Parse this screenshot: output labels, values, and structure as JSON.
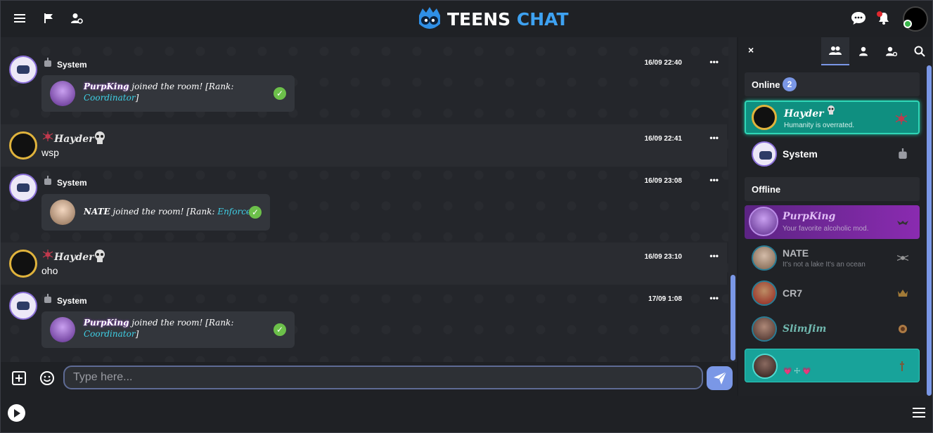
{
  "header": {
    "logo_text_a": "TEENS",
    "logo_text_b": "CHAT"
  },
  "messages": [
    {
      "user": "System",
      "time": "16/09 22:40",
      "menu": "•••",
      "notice": {
        "who": "PurpKing",
        "pre": " joined the room! [Rank: ",
        "rank": "Coordinator",
        "post": "]"
      }
    },
    {
      "user": "Hayder",
      "time": "16/09 22:41",
      "menu": "•••",
      "text": "wsp"
    },
    {
      "user": "System",
      "time": "16/09 23:08",
      "menu": "•••",
      "notice": {
        "who": "NATE",
        "pre": " joined the room! [Rank: ",
        "rank": "Enforcer",
        "post": "]"
      }
    },
    {
      "user": "Hayder",
      "time": "16/09 23:10",
      "menu": "•••",
      "text": "oho"
    },
    {
      "user": "System",
      "time": "17/09 1:08",
      "menu": "•••",
      "notice": {
        "who": "PurpKing",
        "pre": " joined the room! [Rank: ",
        "rank": "Coordinator",
        "post": "]"
      }
    }
  ],
  "input": {
    "placeholder": "Type here..."
  },
  "panel": {
    "close": "×",
    "online_label": "Online",
    "online_count": "2",
    "offline_label": "Offline",
    "online_users": [
      {
        "name": "Hayder",
        "mood": "Humanity is overrated."
      },
      {
        "name": "System",
        "mood": ""
      }
    ],
    "offline_users": [
      {
        "name": "PurpKing",
        "mood": "Your favorite alcoholic mod."
      },
      {
        "name": "NATE",
        "mood": "It's not a lake It's an ocean"
      },
      {
        "name": "CR7",
        "mood": ""
      },
      {
        "name": "SlimJim",
        "mood": ""
      },
      {
        "name": "",
        "mood": "💗 ☩ 💗"
      }
    ]
  },
  "colors": {
    "accent": "#7a97e6",
    "online_highlight": "#0f8f80",
    "purpking_bg": "#8a2bb0",
    "rank_text": "#3fd0e6",
    "check": "#6cc04a"
  },
  "icons": {
    "top_left": [
      "menu-icon",
      "flag-icon",
      "user-settings-icon"
    ],
    "top_right": [
      "chat-bubble-icon",
      "bell-icon"
    ],
    "panel_tabs": [
      "users-icon",
      "user-icon",
      "user-gear-icon",
      "search-icon"
    ]
  }
}
